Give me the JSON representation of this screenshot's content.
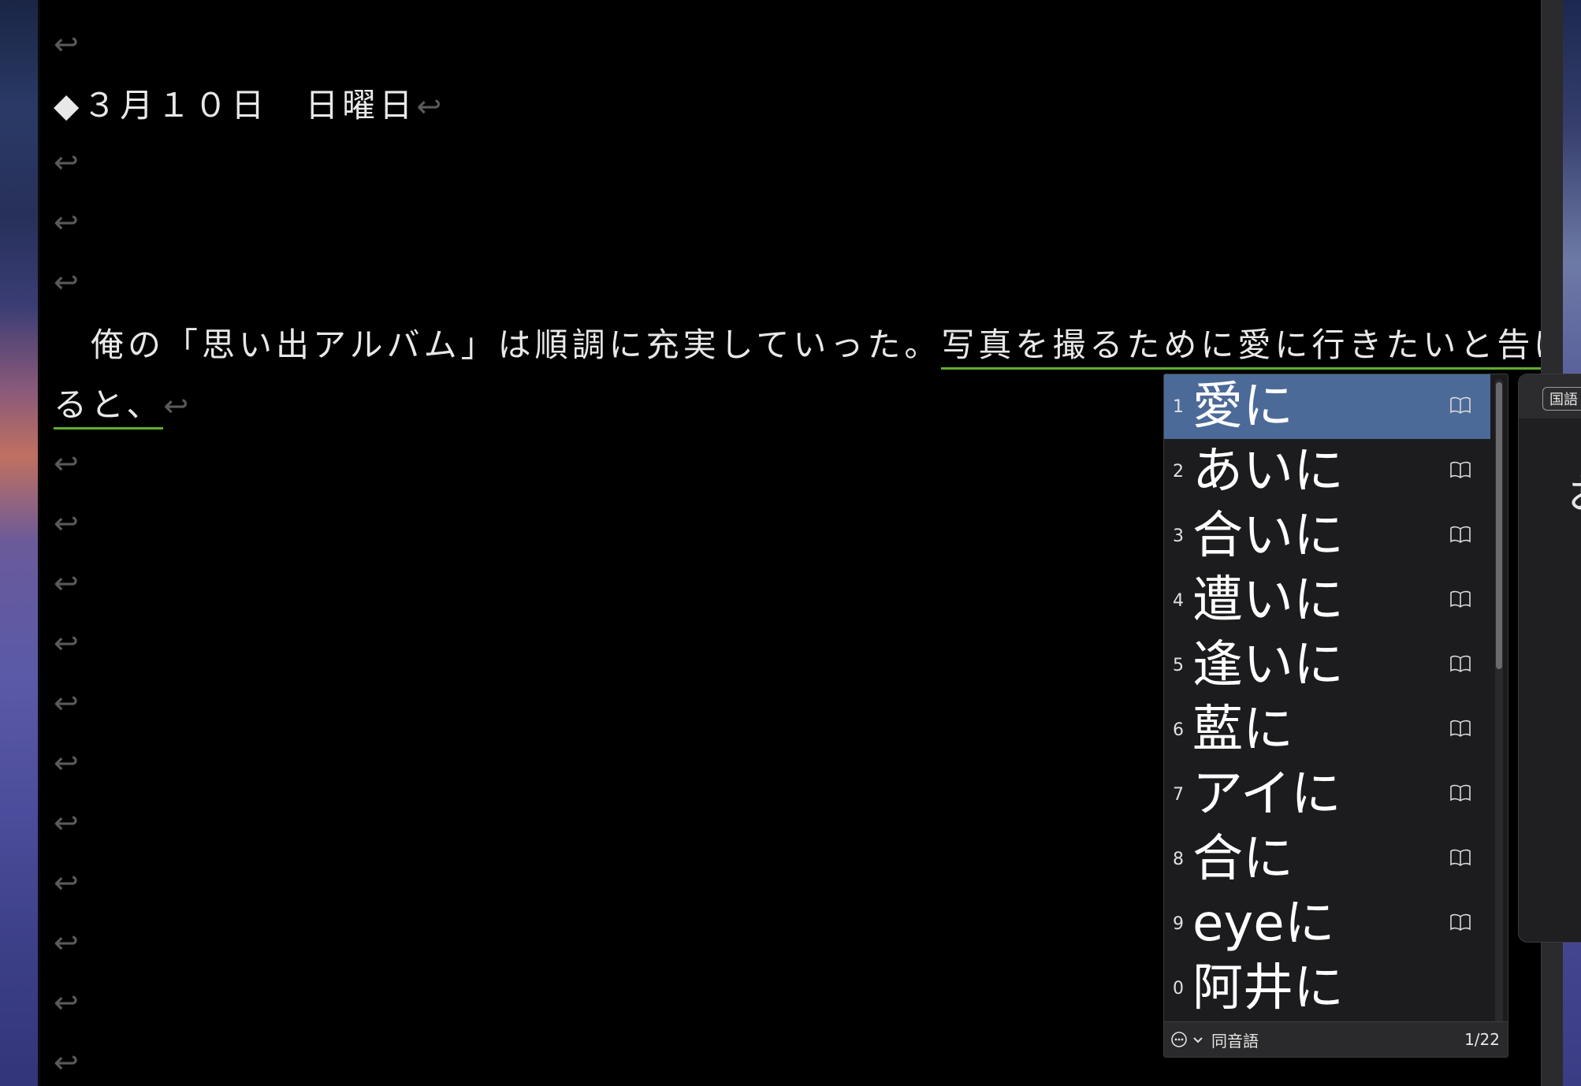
{
  "editor": {
    "return_mark": "↩",
    "heading_line": "◆３月１０日　日曜日",
    "paragraph_line1_plain": "　俺の「思い出アルバム」は順調に充実していった。",
    "paragraph_line1_underlined": "写真を撮るために愛に行きたいと告げ",
    "paragraph_line2_underlined": "ると、"
  },
  "candidates": {
    "items": [
      {
        "num": "1",
        "word": "愛に",
        "selected": true
      },
      {
        "num": "2",
        "word": "あいに"
      },
      {
        "num": "3",
        "word": "合いに"
      },
      {
        "num": "4",
        "word": "遭いに"
      },
      {
        "num": "5",
        "word": "逢いに"
      },
      {
        "num": "6",
        "word": "藍に"
      },
      {
        "num": "7",
        "word": "アイに"
      },
      {
        "num": "8",
        "word": "合に"
      },
      {
        "num": "9",
        "word": "eyeに"
      },
      {
        "num": "0",
        "word": "阿井に"
      }
    ],
    "footer_label": "同音語",
    "page_count": "1/22",
    "icons": [
      "book-icon",
      "options-icon",
      "chevron-down-icon"
    ]
  },
  "dictionary": {
    "tab_label": "国語",
    "visible_char": "お"
  },
  "colors": {
    "selection": "#4c6a98",
    "underline": "#5fae2f",
    "background": "#000000"
  }
}
